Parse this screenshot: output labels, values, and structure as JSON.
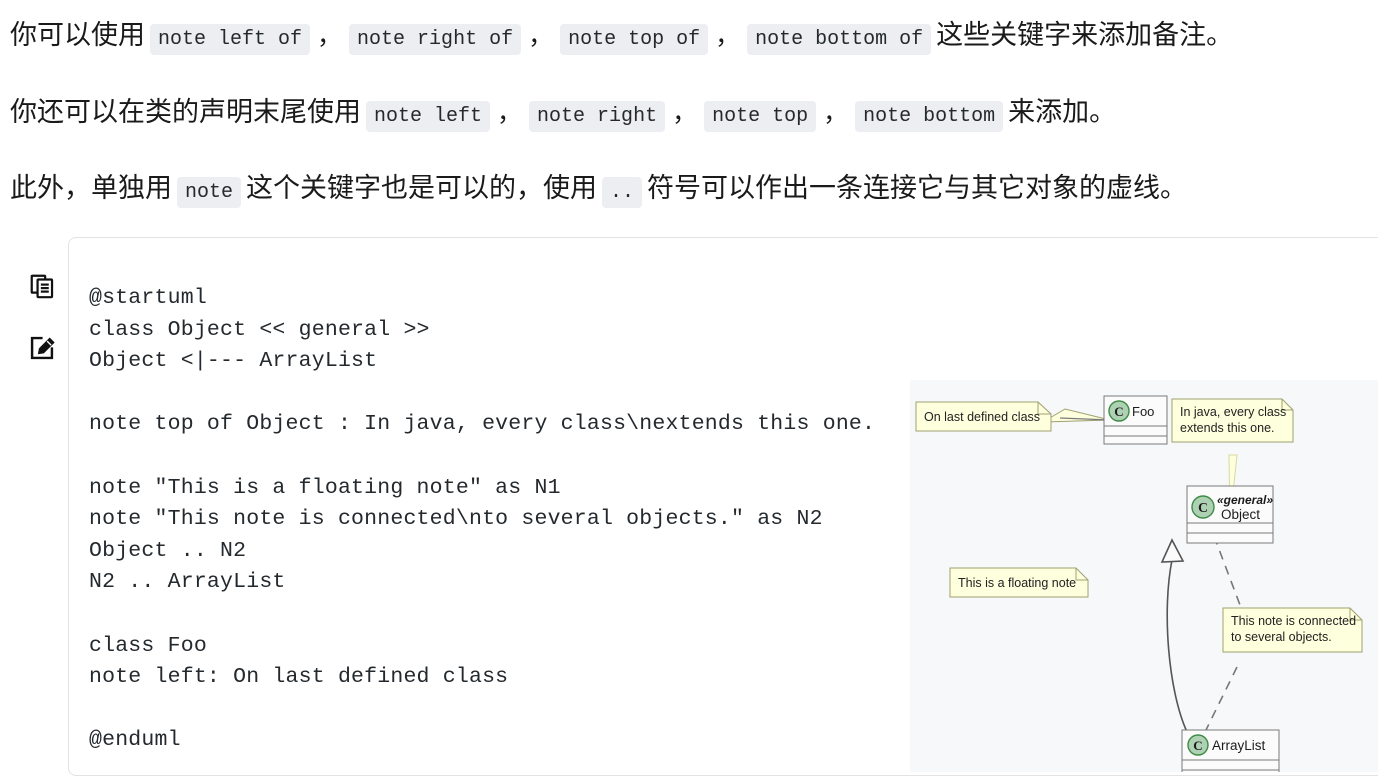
{
  "paragraphs": [
    {
      "id": "para-note-direction",
      "segments": [
        {
          "type": "text",
          "value": "你可以使用"
        },
        {
          "type": "code",
          "value": "note left of"
        },
        {
          "type": "sep",
          "value": "，"
        },
        {
          "type": "code",
          "value": "note right of"
        },
        {
          "type": "sep",
          "value": "，"
        },
        {
          "type": "code",
          "value": "note top of"
        },
        {
          "type": "sep",
          "value": "，"
        },
        {
          "type": "code",
          "value": "note bottom of"
        },
        {
          "type": "text",
          "value": "这些关键字来添加备注。"
        }
      ]
    },
    {
      "id": "para-note-tail",
      "segments": [
        {
          "type": "text",
          "value": "你还可以在类的声明末尾使用"
        },
        {
          "type": "code",
          "value": "note left"
        },
        {
          "type": "sep",
          "value": "，"
        },
        {
          "type": "code",
          "value": "note right"
        },
        {
          "type": "sep",
          "value": "，"
        },
        {
          "type": "code",
          "value": "note top"
        },
        {
          "type": "sep",
          "value": "，"
        },
        {
          "type": "code",
          "value": "note bottom"
        },
        {
          "type": "text",
          "value": "来添加。"
        }
      ]
    },
    {
      "id": "para-note-standalone",
      "segments": [
        {
          "type": "text",
          "value": "此外，单独用"
        },
        {
          "type": "code",
          "value": "note"
        },
        {
          "type": "text",
          "value": "这个关键字也是可以的，使用"
        },
        {
          "type": "code",
          "value": ".."
        },
        {
          "type": "text",
          "value": "符号可以作出一条连接它与其它对象的虚线。"
        }
      ]
    }
  ],
  "gutter": {
    "copy_icon": "copy-icon",
    "edit_icon": "edit-icon"
  },
  "code_block": {
    "language": "plantuml",
    "content": "@startuml\nclass Object << general >>\nObject <|--- ArrayList\n\nnote top of Object : In java, every class\\nextends this one.\n\nnote \"This is a floating note\" as N1\nnote \"This note is connected\\nto several objects.\" as N2\nObject .. N2\nN2 .. ArrayList\n\nclass Foo\nnote left: On last defined class\n\n@enduml"
  },
  "diagram": {
    "background": "#f6f8fa",
    "note_fill": "#feffdd",
    "note_stroke": "#a0a070",
    "class_fill": "#fbfbfb",
    "class_stroke": "#7a7a7a",
    "circle_fill": "#add1b2",
    "circle_stroke": "#3d8b47",
    "classes": [
      {
        "id": "class-foo",
        "name": "Foo",
        "stereotype": "",
        "icon": "C"
      },
      {
        "id": "class-object",
        "name": "Object",
        "stereotype": "«general»",
        "icon": "C"
      },
      {
        "id": "class-arraylist",
        "name": "ArrayList",
        "stereotype": "",
        "icon": "C"
      }
    ],
    "notes": [
      {
        "id": "note-on-last-defined-class",
        "lines": [
          "On last defined class"
        ]
      },
      {
        "id": "note-in-java",
        "lines": [
          "In java, every class",
          "extends this one."
        ]
      },
      {
        "id": "note-floating",
        "lines": [
          "This is a floating note"
        ]
      },
      {
        "id": "note-connected",
        "lines": [
          "This note is connected",
          "to several objects."
        ]
      }
    ]
  }
}
